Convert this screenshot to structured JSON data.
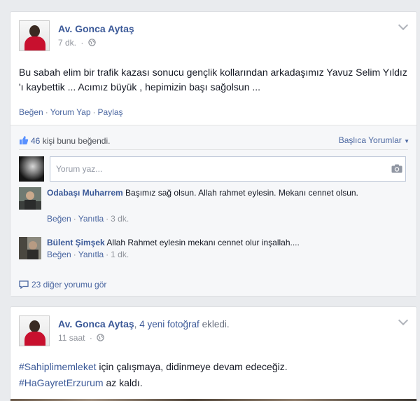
{
  "post1": {
    "author": "Av. Gonca Aytaş",
    "time": "7 dk.",
    "privacy_icon": "globe-icon",
    "text": "Bu sabah elim bir trafik kazası sonucu gençlik kollarından arkadaşımız Yavuz Selim Yıldız 'ı kaybettik ... Acımız büyük , hepimizin başı sağolsun ...",
    "actions": {
      "like": "Beğen",
      "comment": "Yorum Yap",
      "share": "Paylaş"
    },
    "likes_count": "46",
    "likes_text": "kişi bunu beğendi.",
    "top_comments": "Başlıca Yorumlar",
    "comment_placeholder": "Yorum yaz...",
    "comments": [
      {
        "author": "Odabaşı Muharrem",
        "text": "Başımız sağ olsun. Allah rahmet eylesin. Mekanı cennet olsun.",
        "like": "Beğen",
        "reply": "Yanıtla",
        "time": "3 dk."
      },
      {
        "author": "Bülent Şimşek",
        "text": "Allah Rahmet eylesin mekanı cennet olur inşallah....",
        "like": "Beğen",
        "reply": "Yanıtla",
        "time": "1 dk."
      }
    ],
    "more_comments": "23 diğer yorumu gör"
  },
  "post2": {
    "author": "Av. Gonca Aytaş",
    "action_count": "4 yeni fotoğraf",
    "action_suffix": "ekledi.",
    "time": "11 saat",
    "privacy_icon": "globe-icon",
    "hashtag1": "#Sahiplimemleket",
    "text1": "için çalışmaya, didinmeye devam edeceğiz.",
    "hashtag2": "#HaGayretErzurum",
    "text2": "az kaldı."
  },
  "colors": {
    "link": "#3b5998",
    "muted": "#90949c",
    "background": "#e9ebee"
  }
}
